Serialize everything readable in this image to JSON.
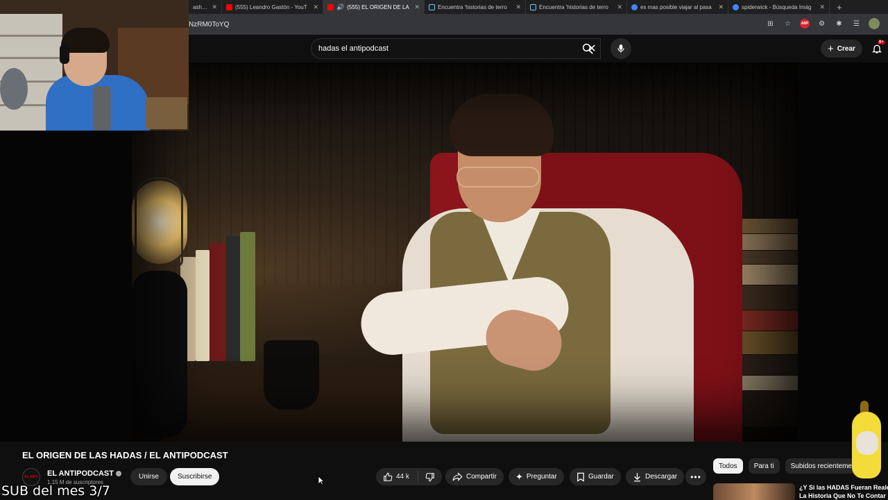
{
  "browser": {
    "tabs": [
      {
        "label": "ashboar",
        "favicon": "dashboard-favicon",
        "active": false
      },
      {
        "label": "(555) Leandro Gastón - YouT",
        "favicon": "youtube-favicon",
        "active": false
      },
      {
        "label": "(555) EL ORIGEN DE LA",
        "favicon": "youtube-favicon",
        "active": true,
        "audio": true
      },
      {
        "label": "Encuentra 'historias de terro",
        "favicon": "tiktok-favicon",
        "active": false
      },
      {
        "label": "Encuentra 'historias de terro",
        "favicon": "tiktok-favicon",
        "active": false
      },
      {
        "label": "es mas posible viajar al pasa",
        "favicon": "google-favicon",
        "active": false
      },
      {
        "label": "spiderwick - Búsqueda Imág",
        "favicon": "google-favicon",
        "active": false
      }
    ],
    "url": "NzRM0ToYQ",
    "extensions": {
      "abp_label": "ABP"
    }
  },
  "youtube_header": {
    "search_value": "hadas  el antipodcast",
    "create_label": "Crear",
    "notifications_badge": "9+"
  },
  "video": {
    "title": "EL ORIGEN DE LAS HADAS / EL ANTIPODCAST",
    "channel_name": "EL ANTIPODCAST",
    "channel_avatar_text": "EL ANTI",
    "subscribers": "1,15 M de suscriptores",
    "join_label": "Unirse",
    "subscribe_label": "Suscribirse",
    "likes": "44 k",
    "share_label": "Compartir",
    "ask_label": "Preguntar",
    "save_label": "Guardar",
    "download_label": "Descargar"
  },
  "sidebar": {
    "chips": [
      "Todos",
      "Para ti",
      "Subidos recientemente"
    ],
    "selected_chip": "Todos",
    "recommendation_title_line1": "¿Y Si las HADAS Fueran Reale",
    "recommendation_title_line2": "La Historia Que No Te Contar"
  },
  "stream_overlay": {
    "sub_counter_text": "SUB del mes 3/7"
  },
  "colors": {
    "youtube_bg": "#0f0f0f",
    "button_bg": "#272727",
    "subscribe_bg": "#f1f1f1",
    "brand_red": "#ff0000"
  }
}
